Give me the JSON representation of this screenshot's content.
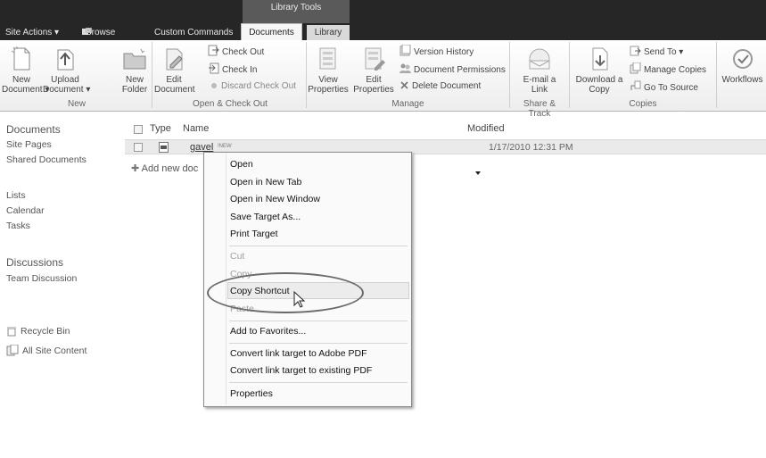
{
  "topbar": {
    "library_tools": "Library Tools",
    "site_actions": "Site Actions ▾",
    "browse": "Browse",
    "custom_commands": "Custom Commands",
    "documents": "Documents",
    "library": "Library"
  },
  "ribbon": {
    "new_document": [
      "New",
      "Document ▾"
    ],
    "upload_document": [
      "Upload",
      "Document ▾"
    ],
    "new_folder": [
      "New",
      "Folder"
    ],
    "group_new": "New",
    "edit_document": [
      "Edit",
      "Document"
    ],
    "check_out": "Check Out",
    "check_in": "Check In",
    "discard_check_out": "Discard Check Out",
    "group_open_checkout": "Open & Check Out",
    "view_properties": [
      "View",
      "Properties"
    ],
    "edit_properties": [
      "Edit",
      "Properties"
    ],
    "version_history": "Version History",
    "document_permissions": "Document Permissions",
    "delete_document": "Delete Document",
    "group_manage": "Manage",
    "email_link": [
      "E-mail a",
      "Link"
    ],
    "group_share": "Share & Track",
    "download_copy": [
      "Download a",
      "Copy"
    ],
    "send_to": "Send To ▾",
    "manage_copies": "Manage Copies",
    "go_to_source": "Go To Source",
    "group_copies": "Copies",
    "workflows": "Workflows"
  },
  "leftnav": {
    "documents": "Documents",
    "site_pages": "Site Pages",
    "shared_documents": "Shared Documents",
    "lists": "Lists",
    "calendar": "Calendar",
    "tasks": "Tasks",
    "discussions": "Discussions",
    "team_discussion": "Team Discussion",
    "recycle_bin": "Recycle Bin",
    "all_site_content": "All Site Content"
  },
  "list": {
    "col_type": "Type",
    "col_name": "Name",
    "col_modified": "Modified",
    "rows": [
      {
        "name": "gavel",
        "badge": "!NEW",
        "modified": "1/17/2010 12:31 PM"
      }
    ],
    "add_new": "Add new doc"
  },
  "context_menu": {
    "items": [
      "Open",
      "Open in New Tab",
      "Open in New Window",
      "Save Target As...",
      "Print Target",
      "Cut",
      "Copy",
      "Copy Shortcut",
      "Paste",
      "Add to Favorites...",
      "Convert link target to Adobe PDF",
      "Convert link target to existing PDF",
      "Properties"
    ]
  }
}
